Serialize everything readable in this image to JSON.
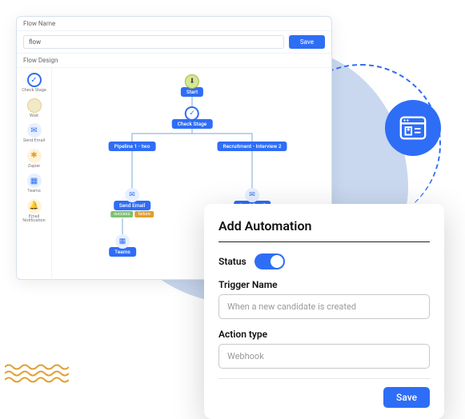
{
  "flow": {
    "name_label": "Flow Name",
    "name_value": "flow",
    "save_label": "Save",
    "design_label": "Flow Design",
    "sidebar": [
      {
        "label": "Check Stage"
      },
      {
        "label": "Wait"
      },
      {
        "label": "Send Email"
      },
      {
        "label": "Zapier"
      },
      {
        "label": "Teams"
      },
      {
        "label": "Email Notification"
      }
    ],
    "nodes": {
      "start": "Start",
      "check_stage": "Check Stage",
      "pipeline": "Pipeline 1 - two",
      "recruitment": "Recruitment - Interview 2",
      "send_email_left": "Send Email",
      "send_email_right": "Send Email",
      "teams": "Teams",
      "success": "success",
      "failure": "failure"
    }
  },
  "automation": {
    "title": "Add Automation",
    "status_label": "Status",
    "status_on": true,
    "trigger_label": "Trigger Name",
    "trigger_value": "When a new candidate is created",
    "action_label": "Action type",
    "action_value": "Webhook",
    "save_label": "Save"
  }
}
